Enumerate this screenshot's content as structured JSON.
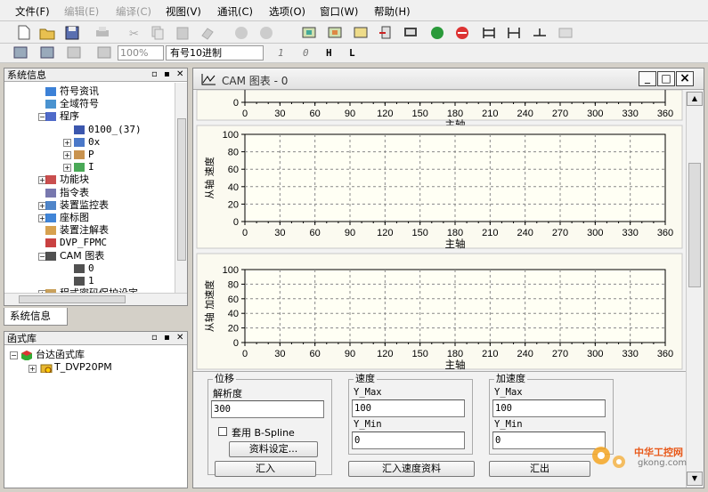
{
  "menu": [
    {
      "label": "文件(F)",
      "enabled": true
    },
    {
      "label": "编辑(E)",
      "enabled": false
    },
    {
      "label": "编译(C)",
      "enabled": false
    },
    {
      "label": "视图(V)",
      "enabled": true
    },
    {
      "label": "通讯(C)",
      "enabled": true
    },
    {
      "label": "选项(O)",
      "enabled": true
    },
    {
      "label": "窗口(W)",
      "enabled": true
    },
    {
      "label": "帮助(H)",
      "enabled": true
    }
  ],
  "toolbar2": {
    "zoom": "100%",
    "number_format": "有号10进制",
    "b1": "1",
    "b2": "0",
    "b3": "H",
    "b4": "L"
  },
  "system_panel": {
    "title": "系统信息",
    "tab": "系统信息",
    "items": [
      {
        "label": "符号资讯",
        "icon": "symbol-info-icon"
      },
      {
        "label": "全域符号",
        "icon": "global-symbol-icon"
      },
      {
        "label": "程序",
        "icon": "program-icon"
      },
      {
        "label": "0100_(37)",
        "icon": "down-arrow-icon"
      },
      {
        "label": "0x",
        "icon": "loop-icon"
      },
      {
        "label": "P",
        "icon": "p-icon"
      },
      {
        "label": "I",
        "icon": "i-icon"
      },
      {
        "label": "功能块",
        "icon": "function-block-icon"
      },
      {
        "label": "指令表",
        "icon": "instruction-table-icon"
      },
      {
        "label": "装置监控表",
        "icon": "monitor-icon"
      },
      {
        "label": "座标图",
        "icon": "coordinate-icon"
      },
      {
        "label": "装置注解表",
        "icon": "annotation-icon"
      },
      {
        "label": "DVP_FPMC",
        "icon": "fpmc-icon"
      },
      {
        "label": "CAM 图表",
        "icon": "cam-icon"
      },
      {
        "label": "0",
        "icon": "cam-sub-icon"
      },
      {
        "label": "1",
        "icon": "cam-sub-icon"
      },
      {
        "label": "程式密码保护设定",
        "icon": "password-icon"
      }
    ]
  },
  "library_panel": {
    "title": "函式库",
    "items": [
      {
        "label": "台达函式库"
      },
      {
        "label": "T_DVP20PM"
      }
    ]
  },
  "cam_window": {
    "title": "CAM 图表 - 0",
    "min": "_",
    "max": "□",
    "close": "×"
  },
  "chart_data": [
    {
      "type": "line",
      "partial": true,
      "xlabel": "主轴",
      "ylabel": "",
      "yticks": [
        "0"
      ],
      "xticks": [
        "0",
        "30",
        "60",
        "90",
        "120",
        "150",
        "180",
        "210",
        "240",
        "270",
        "300",
        "330",
        "360"
      ],
      "xlim": [
        0,
        360
      ],
      "series": [
        {
          "values": []
        }
      ]
    },
    {
      "type": "line",
      "xlabel": "主轴",
      "ylabel": "从轴 速度",
      "ylim": [
        0,
        100
      ],
      "yticks": [
        "0",
        "20",
        "40",
        "60",
        "80",
        "100"
      ],
      "xticks": [
        "0",
        "30",
        "60",
        "90",
        "120",
        "150",
        "180",
        "210",
        "240",
        "270",
        "300",
        "330",
        "360"
      ],
      "xlim": [
        0,
        360
      ],
      "grid": true,
      "series": [
        {
          "values": []
        }
      ]
    },
    {
      "type": "line",
      "xlabel": "主轴",
      "ylabel": "从轴 加速度",
      "ylim": [
        0,
        100
      ],
      "yticks": [
        "0",
        "20",
        "40",
        "60",
        "80",
        "100"
      ],
      "xticks": [
        "0",
        "30",
        "60",
        "90",
        "120",
        "150",
        "180",
        "210",
        "240",
        "270",
        "300",
        "330",
        "360"
      ],
      "xlim": [
        0,
        360
      ],
      "grid": true,
      "series": [
        {
          "values": []
        }
      ]
    }
  ],
  "controls": {
    "displacement": {
      "group": "位移",
      "resolution_label": "解析度",
      "resolution_value": "300",
      "bspline_label": "套用 B-Spline",
      "data_button": "资料设定...",
      "import_button": "汇入"
    },
    "speed": {
      "group": "速度",
      "ymax_label": "Y_Max",
      "ymax_value": "100",
      "ymin_label": "Y_Min",
      "ymin_value": "0",
      "import_button": "汇入速度资料"
    },
    "accel": {
      "group": "加速度",
      "ymax_label": "Y_Max",
      "ymax_value": "100",
      "ymin_label": "Y_Min",
      "ymin_value": "0",
      "export_button": "汇出"
    }
  },
  "watermark": {
    "line1": "中华工控网",
    "line2": "gkong.com"
  }
}
